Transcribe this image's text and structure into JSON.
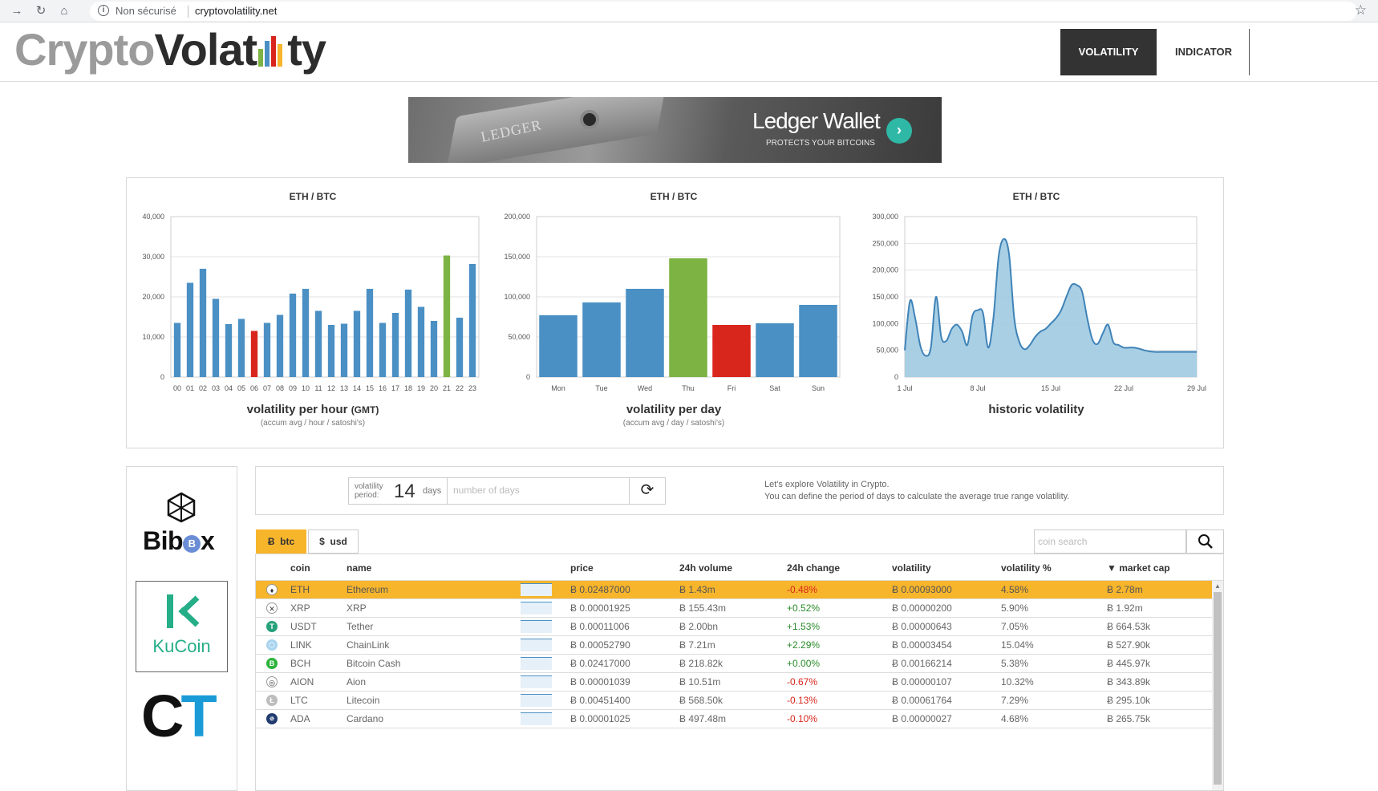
{
  "browser": {
    "security_label": "Non sécurisé",
    "url": "cryptovolatility.net"
  },
  "site": {
    "logo_part1": "Crypto",
    "logo_part2": "Volat",
    "logo_part3": "ty",
    "nav": [
      "VOLATILITY",
      "INDICATOR"
    ]
  },
  "banner": {
    "brand": "LEDGER",
    "title": "Ledger Wallet",
    "subtitle": "PROTECTS YOUR BITCOINS"
  },
  "charts": [
    {
      "title": "ETH / BTC",
      "caption": "volatility per hour",
      "caption_suffix": "(GMT)",
      "sub": "(accum avg / hour / satoshi's)"
    },
    {
      "title": "ETH / BTC",
      "caption": "volatility per day",
      "caption_suffix": "",
      "sub": "(accum avg / day / satoshi's)"
    },
    {
      "title": "ETH / BTC",
      "caption": "historic volatility",
      "caption_suffix": "",
      "sub": ""
    }
  ],
  "chart_data": [
    {
      "type": "bar",
      "title": "ETH / BTC",
      "xlabel": "volatility per hour (GMT)",
      "ylabel": "",
      "ylim": [
        0,
        40000
      ],
      "yticks": [
        "0",
        "10,000",
        "20,000",
        "30,000",
        "40,000"
      ],
      "categories": [
        "00",
        "01",
        "02",
        "03",
        "04",
        "05",
        "06",
        "07",
        "08",
        "09",
        "10",
        "11",
        "12",
        "13",
        "14",
        "15",
        "16",
        "17",
        "18",
        "19",
        "20",
        "21",
        "22",
        "23"
      ],
      "values": [
        13500,
        23500,
        27000,
        19500,
        13200,
        14500,
        11500,
        13500,
        15500,
        20800,
        22000,
        16500,
        13000,
        13300,
        16500,
        22000,
        13500,
        16000,
        21800,
        17500,
        14000,
        30300,
        14800,
        28200
      ],
      "highlight": {
        "6": "#d9261c",
        "21": "#7cb342"
      },
      "color": "#4a90c4"
    },
    {
      "type": "bar",
      "title": "ETH / BTC",
      "xlabel": "volatility per day",
      "ylabel": "",
      "ylim": [
        0,
        200000
      ],
      "yticks": [
        "0",
        "50,000",
        "100,000",
        "150,000",
        "200,000"
      ],
      "categories": [
        "Mon",
        "Tue",
        "Wed",
        "Thu",
        "Fri",
        "Sat",
        "Sun"
      ],
      "values": [
        77000,
        93000,
        110000,
        148000,
        65000,
        67000,
        90000
      ],
      "highlight": {
        "3": "#7cb342",
        "4": "#d9261c"
      },
      "color": "#4a90c4"
    },
    {
      "type": "area",
      "title": "ETH / BTC",
      "xlabel": "historic volatility",
      "ylabel": "",
      "ylim": [
        0,
        300000
      ],
      "yticks": [
        "0",
        "50,000",
        "100,000",
        "150,000",
        "200,000",
        "250,000",
        "300,000"
      ],
      "xticks": [
        "1 Jul",
        "8 Jul",
        "15 Jul",
        "22 Jul",
        "29 Jul"
      ],
      "x": [
        1,
        1.5,
        2,
        2.5,
        3,
        3.5,
        4,
        4.5,
        5,
        5.5,
        6,
        6.5,
        7,
        7.5,
        8,
        8.5,
        9,
        9.5,
        10,
        10.5,
        11,
        11.5,
        12,
        12.5,
        13,
        13.5,
        14,
        14.5,
        15,
        15.5,
        16,
        16.5,
        17,
        17.5,
        18,
        18.5,
        19,
        19.5,
        20,
        20.5,
        21,
        21.5,
        22,
        22.5,
        23,
        23.5,
        24,
        24.5,
        25,
        25.5,
        26,
        26.5,
        27,
        27.5,
        28,
        28.5,
        29
      ],
      "values": [
        50000,
        142000,
        110000,
        58000,
        40000,
        55000,
        150000,
        75000,
        68000,
        90000,
        98000,
        85000,
        60000,
        115000,
        125000,
        120000,
        55000,
        110000,
        225000,
        258000,
        230000,
        110000,
        65000,
        52000,
        60000,
        75000,
        85000,
        90000,
        100000,
        110000,
        125000,
        150000,
        172000,
        172000,
        160000,
        110000,
        70000,
        62000,
        82000,
        98000,
        65000,
        60000,
        55000,
        55000,
        55000,
        53000,
        50000,
        48000,
        47000,
        47000,
        47000,
        47000,
        47000,
        47000,
        47000,
        47000,
        47000
      ],
      "color": "#9ecae1"
    }
  ],
  "sponsors": [
    "Bibox",
    "KuCoin",
    "CT"
  ],
  "controls": {
    "period_label": "volatility period:",
    "period_value": "14",
    "period_unit": "days",
    "days_placeholder": "number of days",
    "explore_line1": "Let's explore Volatility in Crypto.",
    "explore_line2": "You can define the period of days to calculate the average true range volatility."
  },
  "tabs": {
    "btc": "btc",
    "usd": "usd",
    "search_placeholder": "coin search"
  },
  "table": {
    "headers": [
      "coin",
      "name",
      "price",
      "24h volume",
      "24h change",
      "volatility",
      "volatility %",
      "▼ market cap"
    ],
    "rows": [
      {
        "coin": "ETH",
        "name": "Ethereum",
        "price": "Ƀ 0.02487000",
        "volume": "Ƀ 1.43m",
        "change": "-0.48%",
        "volatility": "Ƀ 0.00093000",
        "vol_pct": "4.58%",
        "mcap": "Ƀ 2.78m",
        "icon_color": "#ffffff",
        "icon_glyph": "♦",
        "active": true
      },
      {
        "coin": "XRP",
        "name": "XRP",
        "price": "Ƀ 0.00001925",
        "volume": "Ƀ 155.43m",
        "change": "+0.52%",
        "volatility": "Ƀ 0.00000200",
        "vol_pct": "5.90%",
        "mcap": "Ƀ 1.92m",
        "icon_color": "#ffffff",
        "icon_glyph": "✕",
        "active": false
      },
      {
        "coin": "USDT",
        "name": "Tether",
        "price": "Ƀ 0.00011006",
        "volume": "Ƀ 2.00bn",
        "change": "+1.53%",
        "volatility": "Ƀ 0.00000643",
        "vol_pct": "7.05%",
        "mcap": "Ƀ 664.53k",
        "icon_color": "#26a17b",
        "icon_glyph": "T",
        "active": false
      },
      {
        "coin": "LINK",
        "name": "ChainLink",
        "price": "Ƀ 0.00052790",
        "volume": "Ƀ 7.21m",
        "change": "+2.29%",
        "volatility": "Ƀ 0.00003454",
        "vol_pct": "15.04%",
        "mcap": "Ƀ 527.90k",
        "icon_color": "#a9d4f0",
        "icon_glyph": "⬡",
        "active": false
      },
      {
        "coin": "BCH",
        "name": "Bitcoin Cash",
        "price": "Ƀ 0.02417000",
        "volume": "Ƀ 218.82k",
        "change": "+0.00%",
        "volatility": "Ƀ 0.00166214",
        "vol_pct": "5.38%",
        "mcap": "Ƀ 445.97k",
        "icon_color": "#2bb43a",
        "icon_glyph": "B",
        "active": false
      },
      {
        "coin": "AION",
        "name": "Aion",
        "price": "Ƀ 0.00001039",
        "volume": "Ƀ 10.51m",
        "change": "-0.67%",
        "volatility": "Ƀ 0.00000107",
        "vol_pct": "10.32%",
        "mcap": "Ƀ 343.89k",
        "icon_color": "#ffffff",
        "icon_glyph": "◎",
        "active": false
      },
      {
        "coin": "LTC",
        "name": "Litecoin",
        "price": "Ƀ 0.00451400",
        "volume": "Ƀ 568.50k",
        "change": "-0.13%",
        "volatility": "Ƀ 0.00061764",
        "vol_pct": "7.29%",
        "mcap": "Ƀ 295.10k",
        "icon_color": "#bdbdbd",
        "icon_glyph": "Ł",
        "active": false
      },
      {
        "coin": "ADA",
        "name": "Cardano",
        "price": "Ƀ 0.00001025",
        "volume": "Ƀ 497.48m",
        "change": "-0.10%",
        "volatility": "Ƀ 0.00000027",
        "vol_pct": "4.68%",
        "mcap": "Ƀ 265.75k",
        "icon_color": "#1f3a6e",
        "icon_glyph": "✵",
        "active": false
      }
    ]
  }
}
